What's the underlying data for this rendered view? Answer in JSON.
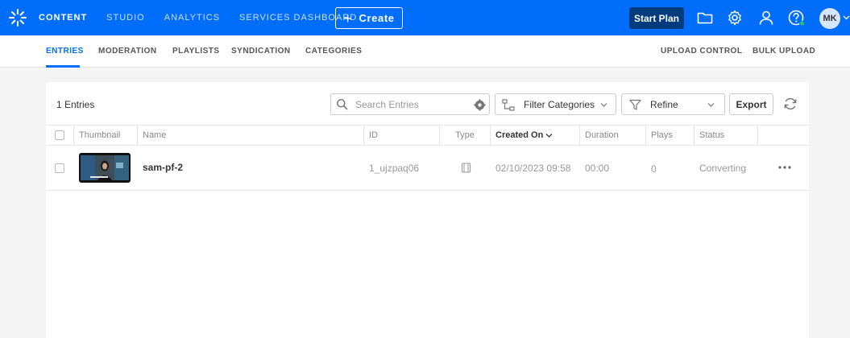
{
  "colors": {
    "brand": "#006efa",
    "start_plan": "#003b7e",
    "thumb_bg": "#111111"
  },
  "topnav": {
    "items": [
      {
        "label": "CONTENT",
        "active": true
      },
      {
        "label": "STUDIO"
      },
      {
        "label": "ANALYTICS"
      },
      {
        "label": "SERVICES DASHBOARD"
      }
    ],
    "create_label": "Create",
    "start_plan_label": "Start Plan",
    "icons": [
      "folder-icon",
      "gear-icon",
      "user-icon",
      "help-icon"
    ],
    "avatar_initials": "MK"
  },
  "subnav": {
    "tabs": [
      "ENTRIES",
      "MODERATION",
      "PLAYLISTS",
      "SYNDICATION",
      "CATEGORIES"
    ],
    "right": [
      "UPLOAD CONTROL",
      "BULK UPLOAD"
    ]
  },
  "toolbar": {
    "count": "1 Entries",
    "search_placeholder": "Search Entries",
    "filter_categories": "Filter Categories",
    "refine": "Refine",
    "export": "Export"
  },
  "table": {
    "columns": [
      "Thumbnail",
      "Name",
      "ID",
      "Type",
      "Created On",
      "Duration",
      "Plays",
      "Status"
    ],
    "rows": [
      {
        "name": "sam-pf-2",
        "id": "1_ujzpaq06",
        "type_icon": "video-icon",
        "created_on": "02/10/2023 09:58",
        "duration": "00:00",
        "plays": "0",
        "status": "Converting"
      }
    ]
  }
}
